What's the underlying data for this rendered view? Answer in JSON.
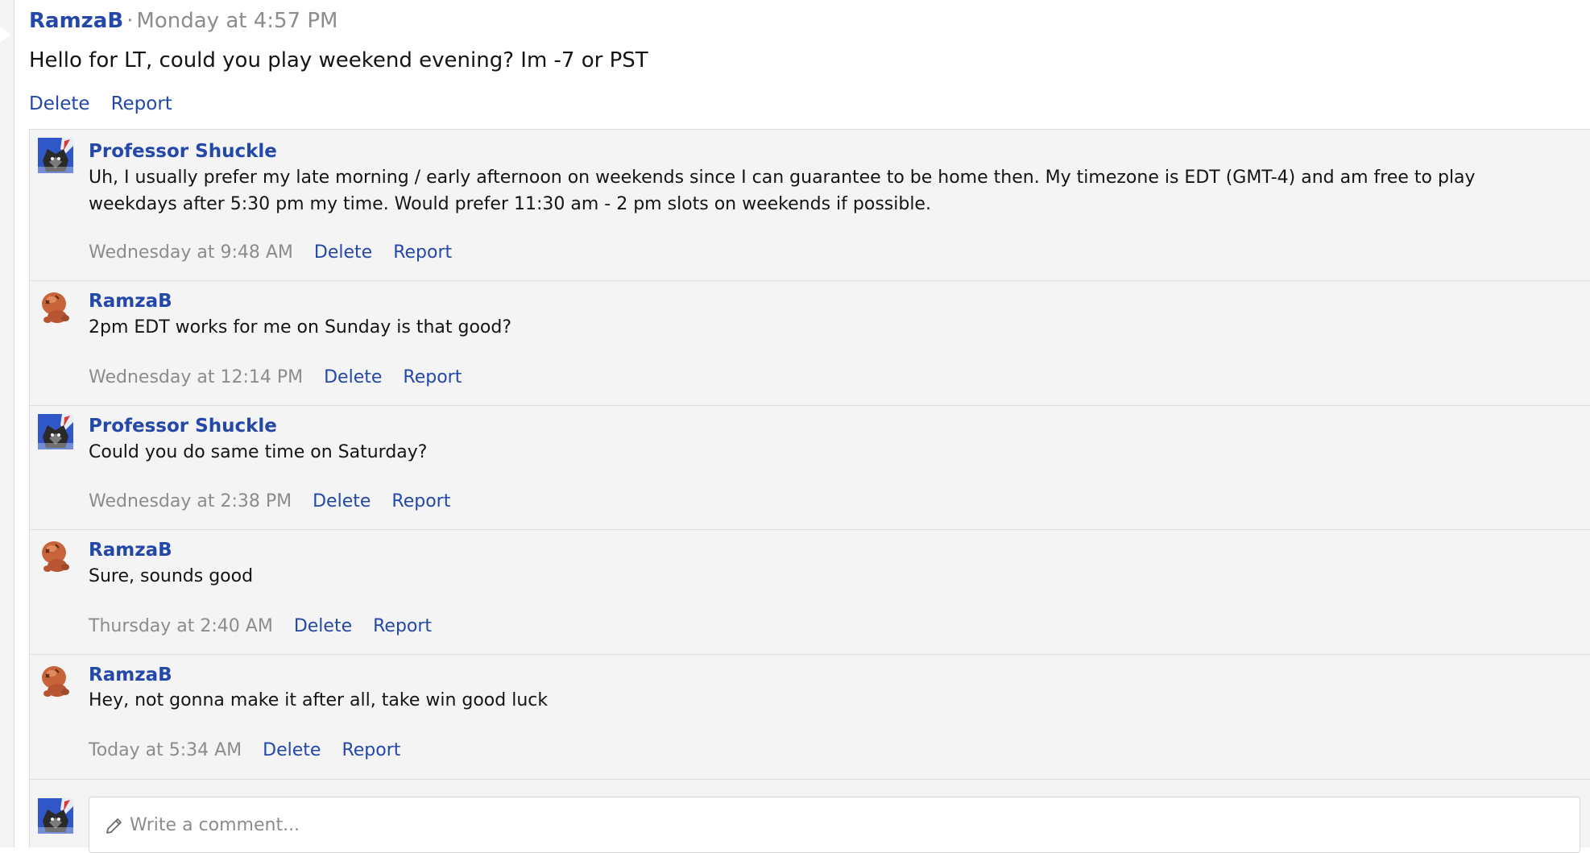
{
  "post": {
    "author": "RamzaB",
    "separator": "·",
    "time": "Monday at 4:57 PM",
    "body": "Hello for LT, could you play weekend evening? Im -7 or PST",
    "delete_label": "Delete",
    "report_label": "Report"
  },
  "comments": [
    {
      "author": "Professor Shuckle",
      "avatar": "professor-shuckle-avatar",
      "text": "Uh, I usually prefer my late morning / early afternoon on weekends since I can guarantee to be home then. My timezone is EDT (GMT-4) and am free to play weekdays after 5:30 pm my time. Would prefer 11:30 am - 2 pm slots on weekends if possible.",
      "time": "Wednesday at 9:48 AM",
      "delete_label": "Delete",
      "report_label": "Report"
    },
    {
      "author": "RamzaB",
      "avatar": "ramzab-avatar",
      "text": "2pm EDT works for me on Sunday is that good?",
      "time": "Wednesday at 12:14 PM",
      "delete_label": "Delete",
      "report_label": "Report"
    },
    {
      "author": "Professor Shuckle",
      "avatar": "professor-shuckle-avatar",
      "text": "Could you do same time on Saturday?",
      "time": "Wednesday at 2:38 PM",
      "delete_label": "Delete",
      "report_label": "Report"
    },
    {
      "author": "RamzaB",
      "avatar": "ramzab-avatar",
      "text": "Sure, sounds good",
      "time": "Thursday at 2:40 AM",
      "delete_label": "Delete",
      "report_label": "Report"
    },
    {
      "author": "RamzaB",
      "avatar": "ramzab-avatar",
      "text": "Hey, not gonna make it after all, take win good luck",
      "time": "Today at 5:34 AM",
      "delete_label": "Delete",
      "report_label": "Report"
    }
  ],
  "reply": {
    "placeholder": "Write a comment...",
    "value": "",
    "icon": "pencil-icon"
  },
  "colors": {
    "link": "#2448a8",
    "muted": "#8c8c8c",
    "panel": "#f4f4f4",
    "border": "#dcdcdc"
  }
}
